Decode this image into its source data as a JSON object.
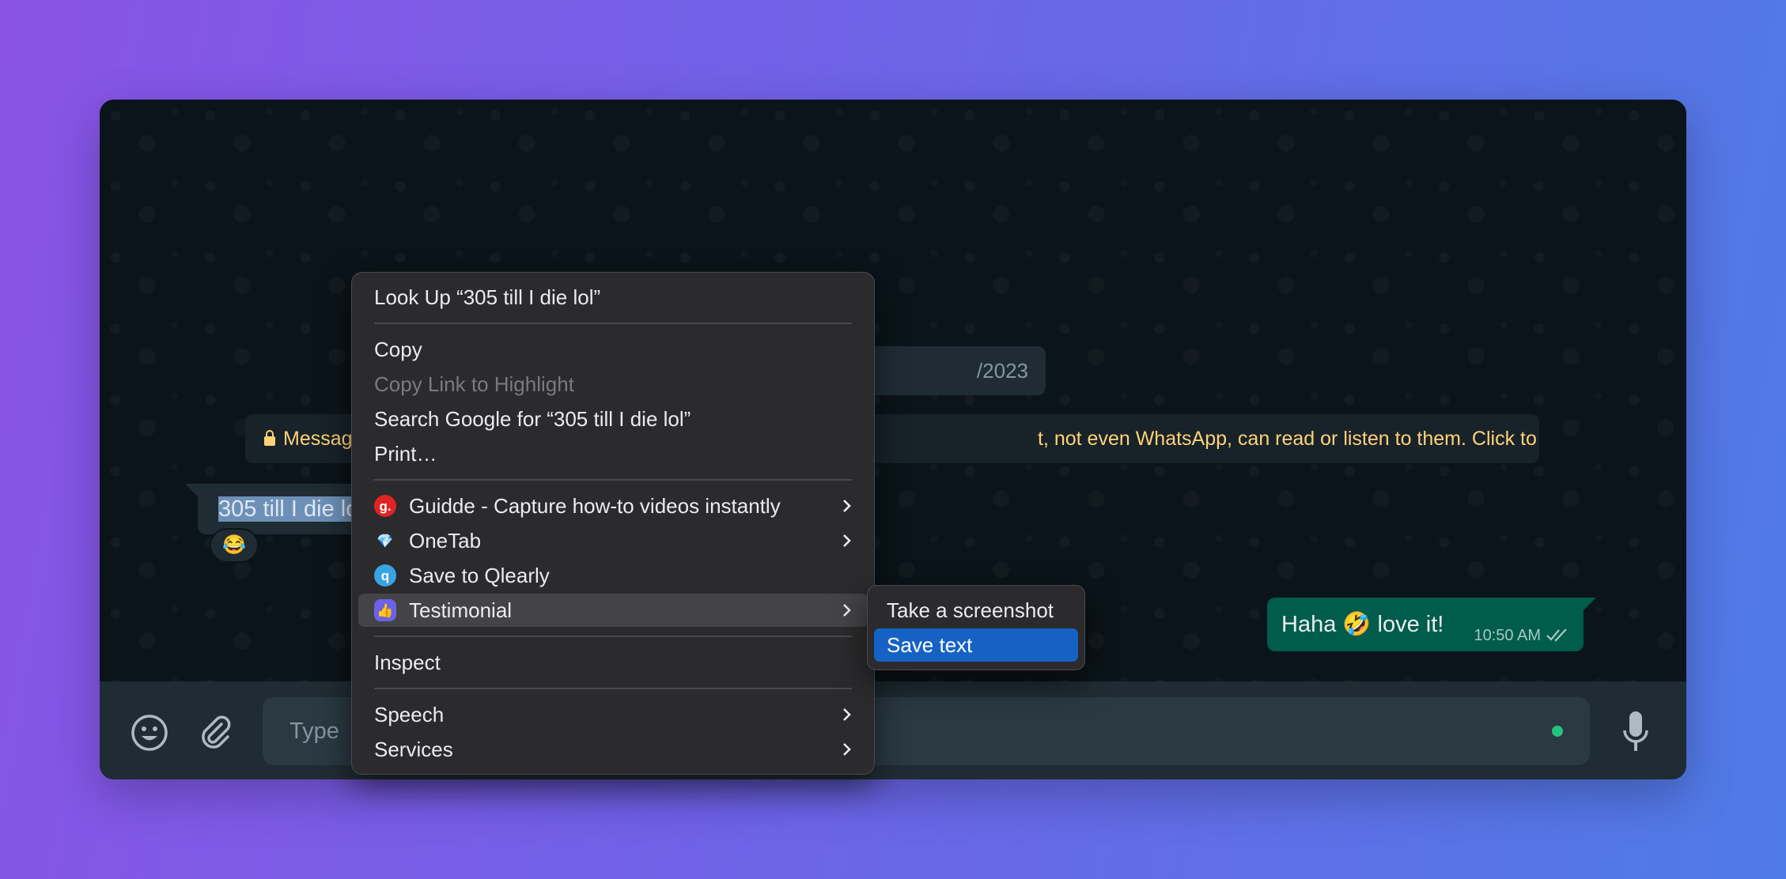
{
  "chat": {
    "date_chip": "/2023",
    "encryption_notice_left": "Messag",
    "encryption_notice_right": "t, not even WhatsApp, can read or listen to them. Click to learn more.",
    "incoming_message_visible": "305 till I die lo",
    "incoming_reaction": "😂",
    "outgoing_message": "Haha 🤣 love it!",
    "outgoing_time": "10:50 AM"
  },
  "composer": {
    "placeholder": "Type"
  },
  "context_menu": {
    "look_up": "Look Up “305 till I die lol”",
    "copy": "Copy",
    "copy_link": "Copy Link to Highlight",
    "search_google": "Search Google for “305 till I die lol”",
    "print": "Print…",
    "guidde": "Guidde - Capture how-to videos instantly",
    "guidde_icon": "g.",
    "onetab": "OneTab",
    "onetab_icon": "💎",
    "qlearly": "Save to Qlearly",
    "qlearly_icon": "q",
    "testimonial": "Testimonial",
    "testimonial_icon": "👍",
    "inspect": "Inspect",
    "speech": "Speech",
    "services": "Services"
  },
  "submenu": {
    "take_screenshot": "Take a screenshot",
    "save_text": "Save text"
  },
  "colors": {
    "selected_item": "#1662c4",
    "outgoing_bubble": "#005c4b",
    "notice_text": "#ffd279"
  }
}
